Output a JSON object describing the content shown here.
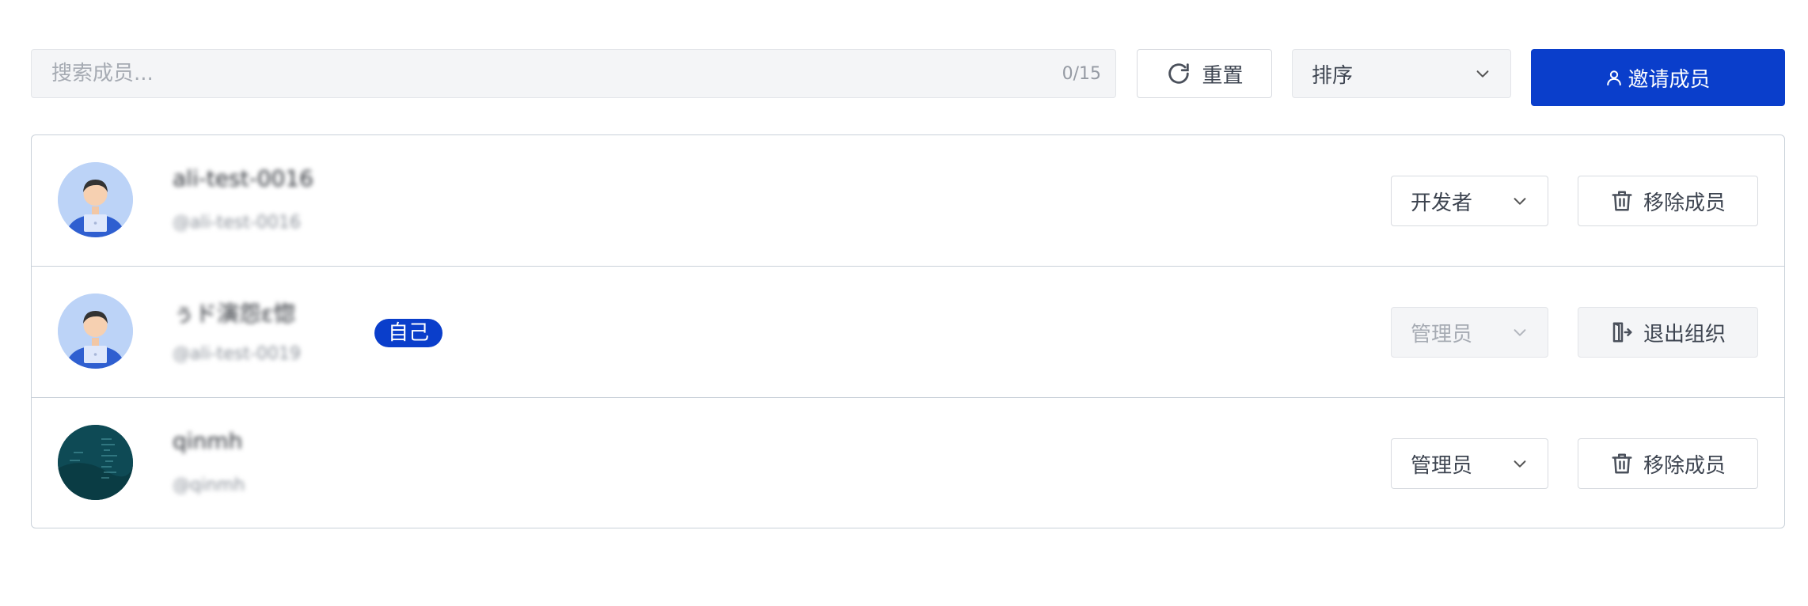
{
  "search": {
    "placeholder": "搜索成员...",
    "count": "0/15"
  },
  "toolbar": {
    "reset_label": "重置",
    "sort_label": "排序",
    "invite_label": "邀请成员"
  },
  "members": [
    {
      "name": "ali-test-0016",
      "handle": "@ali-test-0016",
      "role": "开发者",
      "role_disabled": false,
      "action_label": "移除成员",
      "action_icon": "trash-icon",
      "avatar": "developer-avatar"
    },
    {
      "name": "ぅド演怨ε惚",
      "handle": "@ali-test-0019",
      "self_badge": "自己",
      "role": "管理员",
      "role_disabled": true,
      "action_label": "退出组织",
      "action_icon": "exit-icon",
      "avatar": "developer-avatar"
    },
    {
      "name": "qinmh",
      "handle": "@qinmh",
      "role": "管理员",
      "role_disabled": false,
      "action_label": "移除成员",
      "action_icon": "trash-icon",
      "avatar": "code-avatar"
    }
  ],
  "colors": {
    "primary": "#0a3ecb",
    "border": "#c9d1d9",
    "input_bg": "#f4f5f7"
  }
}
